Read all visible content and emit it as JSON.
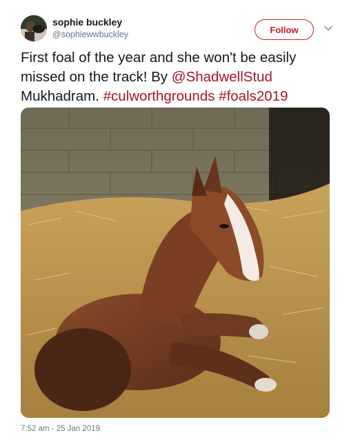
{
  "user": {
    "display_name": "sophie buckley",
    "handle": "@sophiewwbuckley",
    "avatar_icon": "user-avatar"
  },
  "actions": {
    "follow_label": "Follow",
    "menu_icon": "chevron-down-icon"
  },
  "tweet": {
    "text_part1": "First foal of the year and she won't be easily missed on the track! By ",
    "mention": "@ShadwellStud",
    "text_part2": " Mukhadram. ",
    "hashtag1": "#culworthgrounds",
    "hashtag2": "#foals2019"
  },
  "media": {
    "alt": "Chestnut foal with a white blaze lying in straw bedding"
  },
  "meta": {
    "timestamp": "7:52 am - 25 Jan 2019"
  },
  "colors": {
    "link": "#a4161f",
    "follow_border": "#c51e28",
    "secondary_text": "#657786"
  }
}
